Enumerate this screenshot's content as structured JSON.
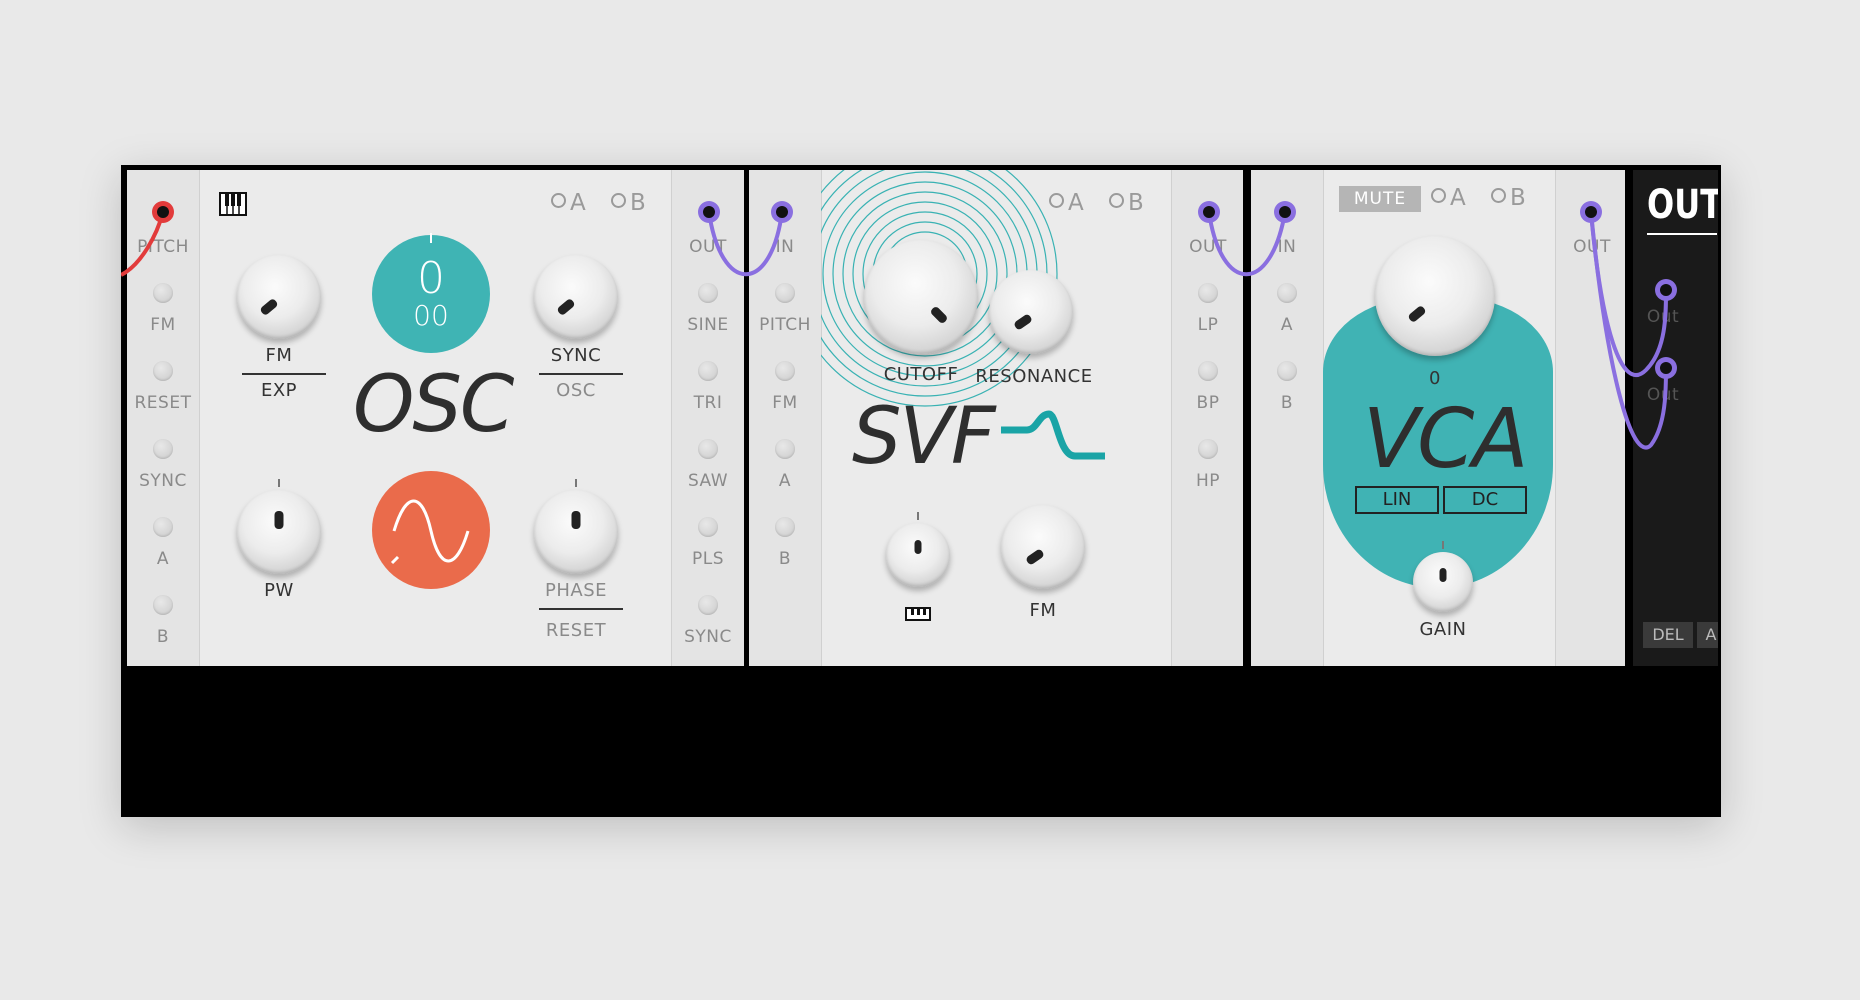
{
  "osc": {
    "jacks_left": [
      "PITCH",
      "FM",
      "RESET",
      "SYNC",
      "A",
      "B"
    ],
    "jacks_right": [
      "OUT",
      "SINE",
      "TRI",
      "SAW",
      "PLS",
      "SYNC"
    ],
    "ab_a": "A",
    "ab_b": "B",
    "knob_fm": "FM",
    "knob_fm_sub": "EXP",
    "knob_sync": "SYNC",
    "knob_sync_sub": "OSC",
    "knob_pw": "PW",
    "knob_phase": "PHASE",
    "knob_phase_sub": "RESET",
    "display_top": "0",
    "display_bottom": "00",
    "title": "OSC",
    "display_color": "#3fb4b4",
    "wave_color": "#ea6b4b"
  },
  "svf": {
    "jacks_left": [
      "IN",
      "PITCH",
      "FM",
      "A",
      "B"
    ],
    "jacks_right": [
      "OUT",
      "LP",
      "BP",
      "HP"
    ],
    "ab_a": "A",
    "ab_b": "B",
    "knob_cutoff": "CUTOFF",
    "knob_resonance": "RESONANCE",
    "knob_keytrack_icon": "keyboard-icon",
    "knob_fm": "FM",
    "title": "SVF",
    "accent": "#1aa4a6"
  },
  "vca": {
    "jacks_left": [
      "IN",
      "A",
      "B"
    ],
    "jacks_right": [
      "OUT"
    ],
    "mute": "MUTE",
    "ab_a": "A",
    "ab_b": "B",
    "knob_value": "0",
    "title": "VCA",
    "btn_lin": "LIN",
    "btn_dc": "DC",
    "knob_gain": "GAIN",
    "accent": "#40b3b4"
  },
  "out": {
    "title": "OUT",
    "jacks": [
      "Out",
      "Out"
    ],
    "btn_del": "DEL",
    "btn_a": "A"
  },
  "cables": {
    "red": "#e23b3b",
    "purple": "#8a6fe0"
  }
}
